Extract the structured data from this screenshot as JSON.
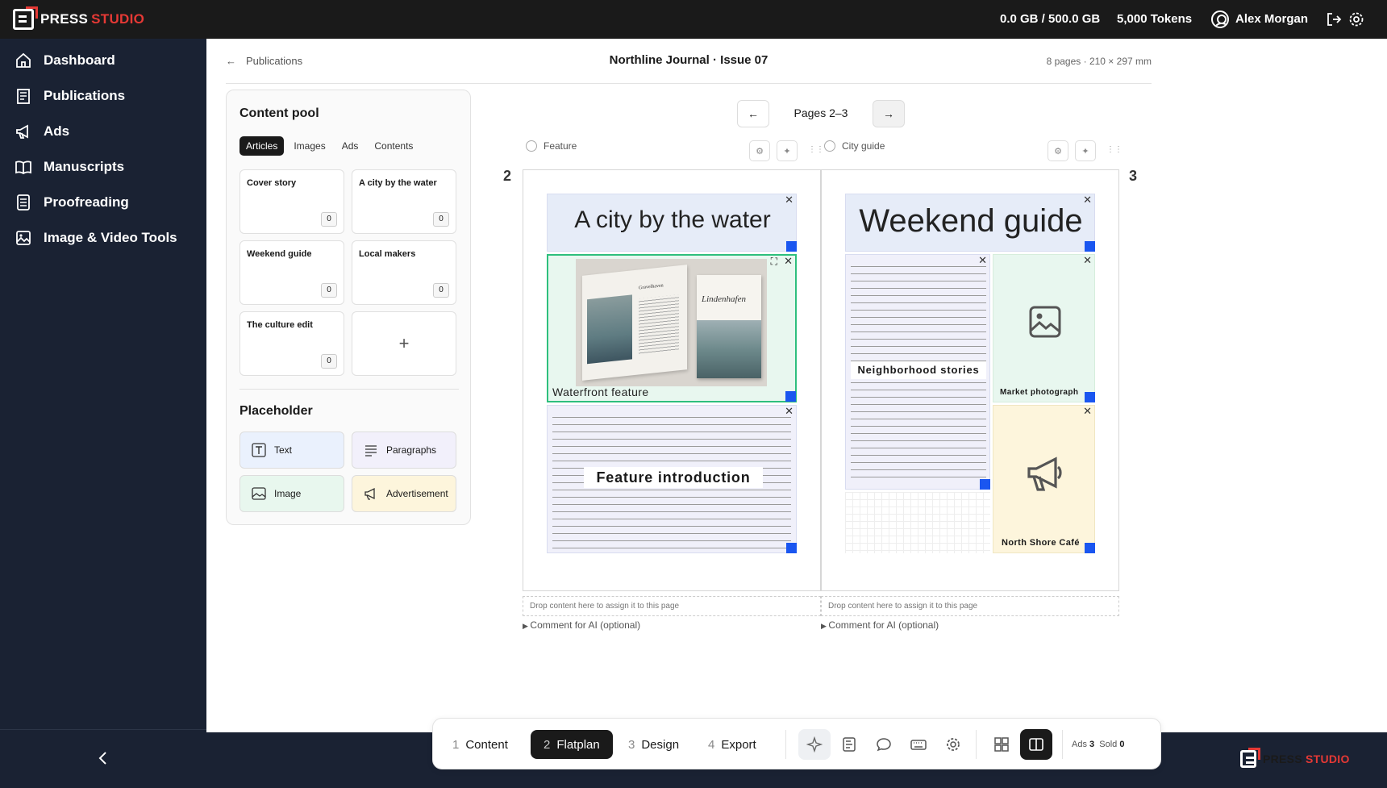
{
  "app": {
    "brand_a": "PRESS",
    "brand_b": "STUDIO"
  },
  "topbar": {
    "storage": "0.0 GB / 500.0 GB",
    "tokens": "5,000 Tokens",
    "user": "Alex Morgan"
  },
  "sidebar": {
    "items": [
      {
        "label": "Dashboard",
        "icon": "home-icon"
      },
      {
        "label": "Publications",
        "icon": "publications-icon"
      },
      {
        "label": "Ads",
        "icon": "megaphone-icon"
      },
      {
        "label": "Manuscripts",
        "icon": "book-icon"
      },
      {
        "label": "Proofreading",
        "icon": "document-icon"
      },
      {
        "label": "Image & Video Tools",
        "icon": "image-icon"
      }
    ]
  },
  "header": {
    "back": "Publications",
    "title": "Northline Journal · Issue 07",
    "meta": "8 pages · 210 × 297 mm"
  },
  "pool": {
    "title": "Content pool",
    "tabs": [
      "Articles",
      "Images",
      "Ads",
      "Contents"
    ],
    "cards": [
      {
        "title": "Cover story",
        "count": "0"
      },
      {
        "title": "A city by the water",
        "count": "0"
      },
      {
        "title": "Weekend guide",
        "count": "0"
      },
      {
        "title": "Local makers",
        "count": "0"
      },
      {
        "title": "The culture edit",
        "count": "0"
      }
    ],
    "add": "+",
    "placeholder_title": "Placeholder",
    "placeholders": [
      "Text",
      "Paragraphs",
      "Image",
      "Advertisement"
    ]
  },
  "pager": {
    "label": "Pages 2–3",
    "prev": "←",
    "next": "→"
  },
  "pages": [
    {
      "number": "2",
      "template": "Feature",
      "heading": "A city by the water",
      "caption": "Waterfront feature",
      "intro": "Feature introduction",
      "drop": "Drop content here to assign it to this page",
      "comment": "Comment for AI (optional)",
      "book_title_left": "Gravelhaven",
      "book_title_right": "Lindenhafen"
    },
    {
      "number": "3",
      "template": "City guide",
      "heading": "Weekend guide",
      "stories": "Neighborhood stories",
      "photo": "Market photograph",
      "ad": "North Shore Café",
      "drop": "Drop content here to assign it to this page",
      "comment": "Comment for AI (optional)"
    }
  ],
  "toolbar": {
    "steps": [
      {
        "n": "1",
        "label": "Content"
      },
      {
        "n": "2",
        "label": "Flatplan"
      },
      {
        "n": "3",
        "label": "Design"
      },
      {
        "n": "4",
        "label": "Export"
      }
    ],
    "ads_label": "Ads",
    "ads_count": "3",
    "sold_label": "Sold",
    "sold_count": "0"
  },
  "colors": {
    "topbar": "#1a1a1a",
    "sidebar": "#1a2233",
    "accent": "#e53935",
    "handle": "#1a56f0",
    "selection": "#2ebf7d"
  }
}
